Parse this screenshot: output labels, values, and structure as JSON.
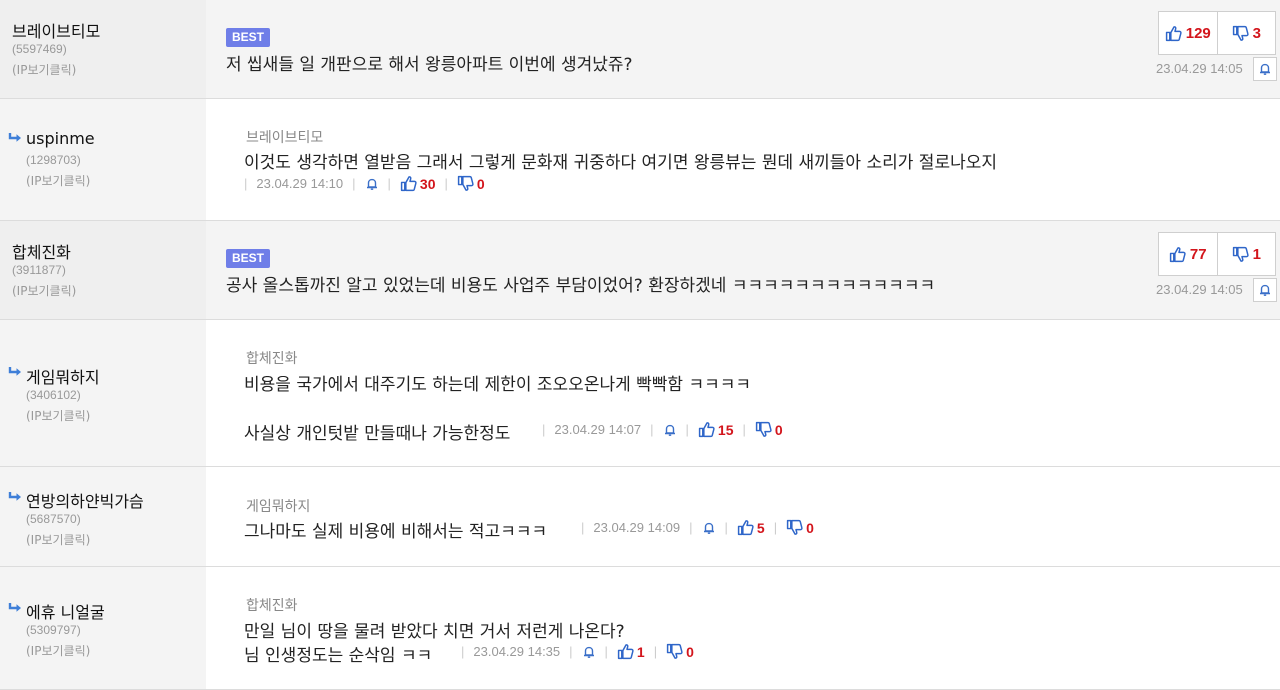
{
  "common": {
    "ip_label": "(IP보기클릭)",
    "best_label": "BEST"
  },
  "comments": [
    {
      "author": "브레이브티모",
      "uid": "(5597469)",
      "text": "저 씹새들 일 개판으로 해서 왕릉아파트 이번에 생겨났쥬?",
      "date": "23.04.29 14:05",
      "up": "129",
      "down": "3"
    },
    {
      "author": "uspinme",
      "uid": "(1298703)",
      "parent": "브레이브티모",
      "text": "이것도 생각하면 열받음 그래서 그렇게 문화재 귀중하다 여기면 왕릉뷰는 뭔데 새끼들아 소리가 절로나오지",
      "date": "23.04.29 14:10",
      "up": "30",
      "down": "0"
    },
    {
      "author": "합체진화",
      "uid": "(3911877)",
      "text": "공사 올스톱까진 알고 있었는데 비용도 사업주 부담이었어? 환장하겠네 ㅋㅋㅋㅋㅋㅋㅋㅋㅋㅋㅋㅋㅋ",
      "date": "23.04.29 14:05",
      "up": "77",
      "down": "1"
    },
    {
      "author": "게임뭐하지",
      "uid": "(3406102)",
      "parent": "합체진화",
      "text": "비용을 국가에서 대주기도 하는데 제한이 조오오온나게 빡빡함 ㅋㅋㅋㅋ",
      "text2": "사실상 개인텃밭 만들때나 가능한정도",
      "date": "23.04.29 14:07",
      "up": "15",
      "down": "0"
    },
    {
      "author": "연방의하얀빅가슴",
      "uid": "(5687570)",
      "parent": "게임뭐하지",
      "text": "그나마도 실제 비용에 비해서는 적고ㅋㅋㅋ",
      "date": "23.04.29 14:09",
      "up": "5",
      "down": "0"
    },
    {
      "author": "에휴 니얼굴",
      "uid": "(5309797)",
      "parent": "합체진화",
      "text": "만일 님이 땅을 물려 받았다 치면 거서 저런게 나온다?",
      "text2": "님 인생정도는 순삭임 ㅋㅋ",
      "date": "23.04.29 14:35",
      "up": "1",
      "down": "0"
    }
  ],
  "colors": {
    "accent": "#6f7ee8",
    "vote": "#d3151c",
    "thumb": "#2f66c9"
  }
}
